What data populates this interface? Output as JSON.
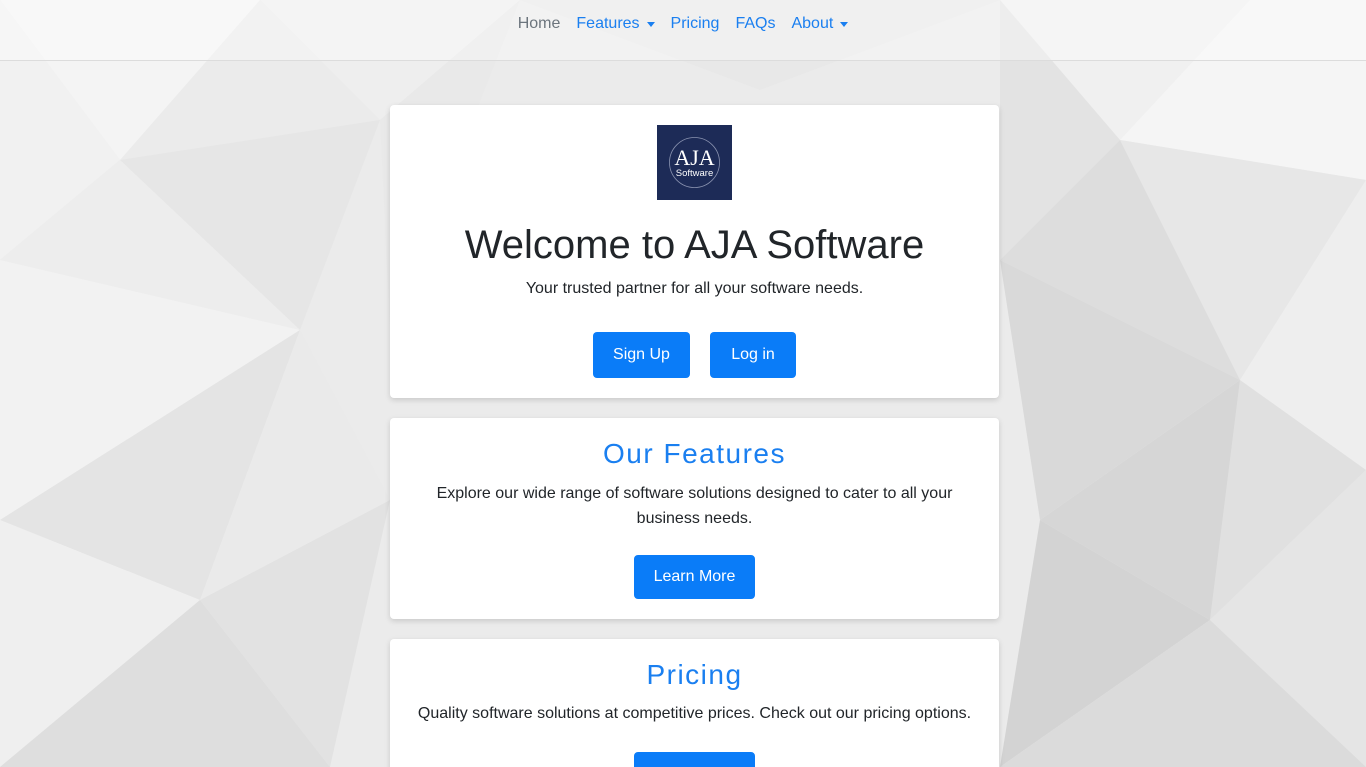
{
  "nav": {
    "items": [
      {
        "label": "Home",
        "active": true,
        "dropdown": false
      },
      {
        "label": "Features",
        "active": false,
        "dropdown": true
      },
      {
        "label": "Pricing",
        "active": false,
        "dropdown": false
      },
      {
        "label": "FAQs",
        "active": false,
        "dropdown": false
      },
      {
        "label": "About",
        "active": false,
        "dropdown": true
      }
    ]
  },
  "welcome": {
    "logo_main": "AJA",
    "logo_sub": "Software",
    "title": "Welcome to AJA Software",
    "subtitle": "Your trusted partner for all your software needs.",
    "signup_label": "Sign Up",
    "login_label": "Log in"
  },
  "features": {
    "title": "Our Features",
    "description": "Explore our wide range of software solutions designed to cater to all your business needs.",
    "button_label": "Learn More"
  },
  "pricing": {
    "title": "Pricing",
    "description": "Quality software solutions at competitive prices. Check out our pricing options."
  },
  "colors": {
    "accent": "#0a7cf8",
    "link": "#1a7ff0",
    "logo_bg": "#1d2b57",
    "text": "#212529",
    "nav_active": "#6c757d"
  }
}
